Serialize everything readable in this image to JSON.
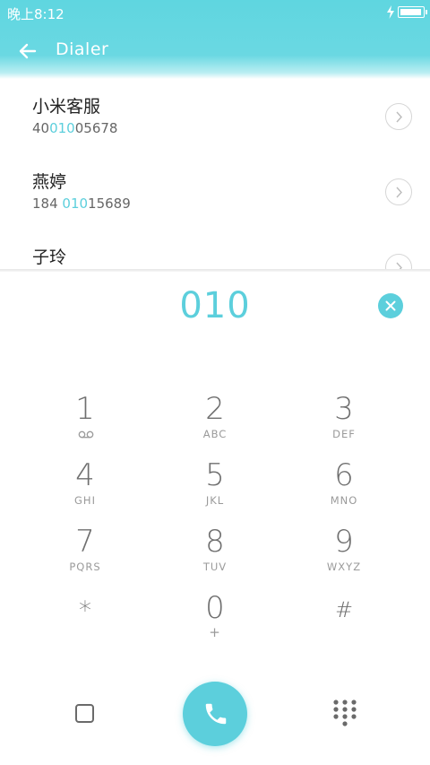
{
  "status_bar": {
    "time": "晚上8:12",
    "battery_level": 1.0
  },
  "app_bar": {
    "title": "Dialer",
    "back_icon": "arrow-left-icon"
  },
  "contacts": [
    {
      "name": "小米客服",
      "number_pre": "40",
      "number_match": "010",
      "number_post": "05678"
    },
    {
      "name": "燕婷",
      "number_pre": "184 ",
      "number_match": "010",
      "number_post": "15689"
    },
    {
      "name": "子玲",
      "number_pre": "",
      "number_match": "",
      "number_post": ""
    }
  ],
  "dial": {
    "input": "010",
    "clear_icon": "clear-icon"
  },
  "keypad": [
    {
      "digit": "1",
      "letters": ""
    },
    {
      "digit": "2",
      "letters": "ABC"
    },
    {
      "digit": "3",
      "letters": "DEF"
    },
    {
      "digit": "4",
      "letters": "GHI"
    },
    {
      "digit": "5",
      "letters": "JKL"
    },
    {
      "digit": "6",
      "letters": "MNO"
    },
    {
      "digit": "7",
      "letters": "PQRS"
    },
    {
      "digit": "8",
      "letters": "TUV"
    },
    {
      "digit": "9",
      "letters": "WXYZ"
    },
    {
      "digit": "*",
      "letters": ""
    },
    {
      "digit": "0",
      "letters": "+"
    },
    {
      "digit": "#",
      "letters": ""
    }
  ],
  "colors": {
    "accent": "#5ccfdc",
    "header": "#62d6e0"
  }
}
